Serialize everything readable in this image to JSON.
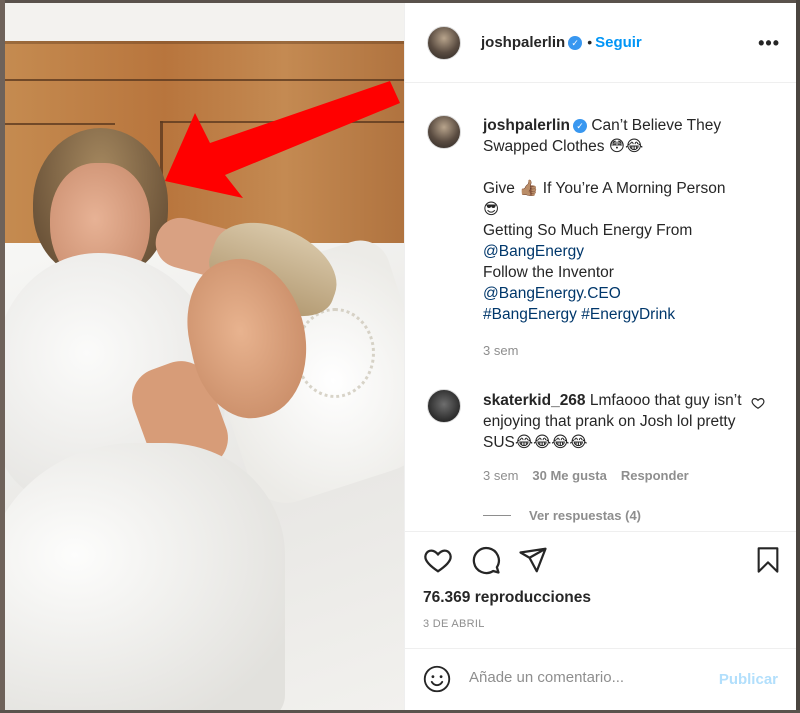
{
  "post": {
    "username": "joshpalerlin",
    "verified_icon": "verified-badge-icon",
    "follow_label": "Seguir",
    "more_icon": "more-options-icon",
    "caption": {
      "lines": [
        "Can’t Believe They",
        "Swapped Clothes 😳😂",
        "",
        "Give 👍🏽 If You’re A Morning Person",
        "😎",
        "Getting So Much Energy From"
      ],
      "mention1": "@BangEnergy",
      "follow_text": "Follow the Inventor",
      "mention2": "@BangEnergy.CEO",
      "hashtag1": "#BangEnergy",
      "hashtag2": "#EnergyDrink"
    },
    "caption_time": "3 sem",
    "comment": {
      "username": "skaterkid_268",
      "text": "Lmfaooo that guy isn’t enjoying that prank on Josh lol pretty SUS😂😂😂😂",
      "time": "3 sem",
      "likes": "30 Me gusta",
      "reply_label": "Responder",
      "view_replies": "Ver respuestas (4)"
    },
    "views": "76.369 reproducciones",
    "date": "3 DE ABRIL",
    "add_comment_placeholder": "Añade un comentario...",
    "publish_label": "Publicar"
  },
  "colors": {
    "link": "#00376b",
    "follow": "#0095f6",
    "arrow": "#ff0000",
    "publish_disabled": "#b2dffc"
  }
}
